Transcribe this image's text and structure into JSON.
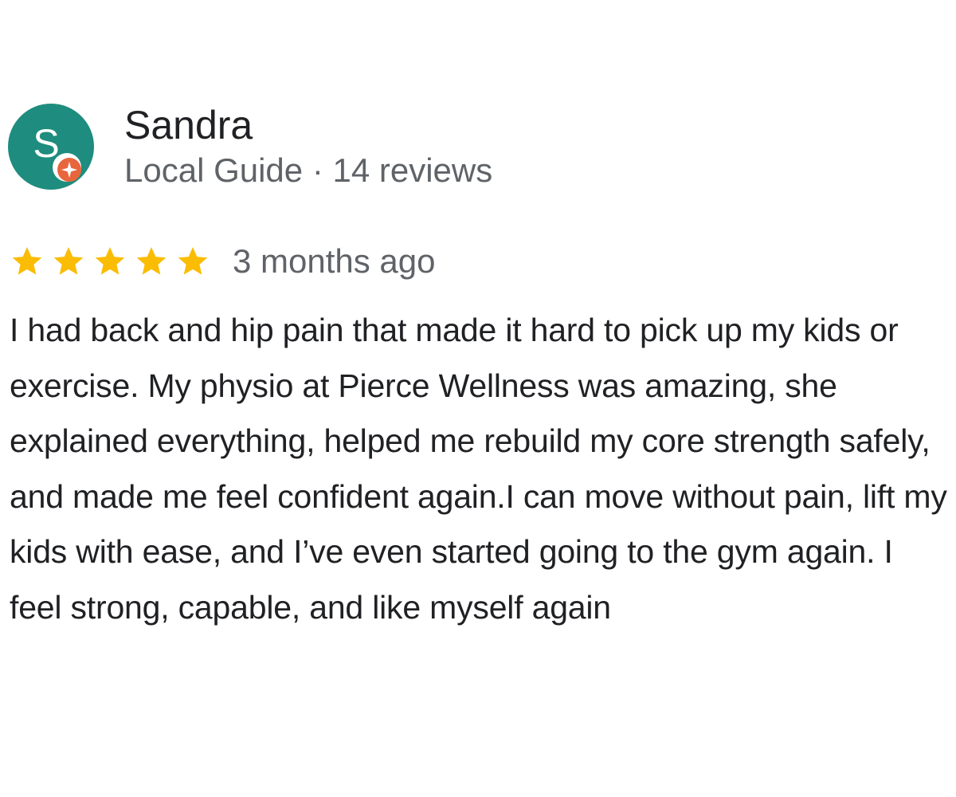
{
  "reviewer": {
    "initial": "S",
    "name": "Sandra",
    "meta": "Local Guide · 14 reviews",
    "avatar_color": "#1e8c7e",
    "badge_icon": "local-guide-badge-icon",
    "badge_color": "#e8663d"
  },
  "rating": {
    "stars": 5,
    "max_stars": 5,
    "star_color": "#fbbc04",
    "date": "3 months ago"
  },
  "review": {
    "text": "I had back and hip pain that made it hard to pick up my kids or exercise. My physio at Pierce Wellness was amazing, she explained everything, helped me rebuild my core strength safely, and made me feel confident again.I can move without pain, lift my kids with ease, and I’ve even started going to the gym again. I feel strong, capable, and like myself again"
  }
}
